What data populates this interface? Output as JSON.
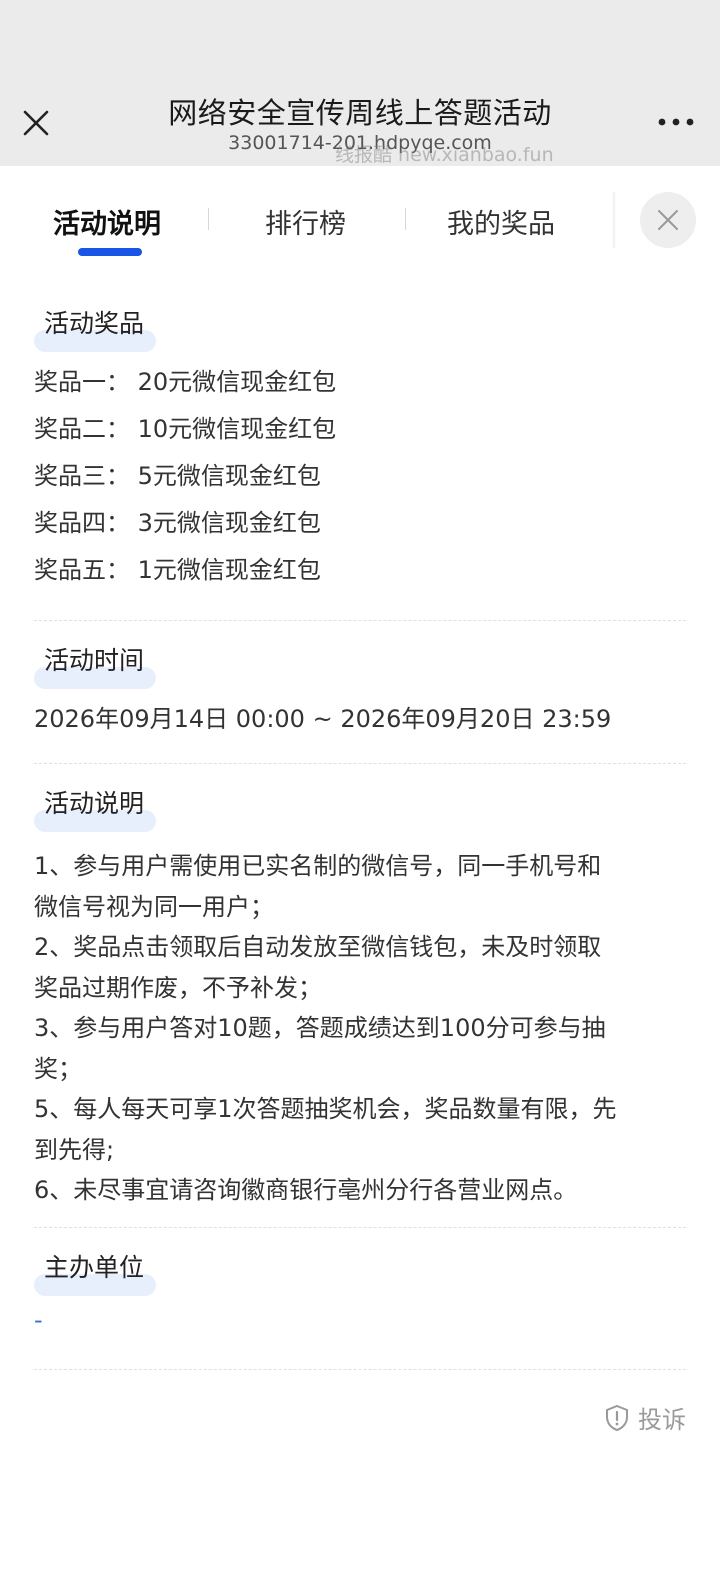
{
  "header": {
    "title": "网络安全宣传周线上答题活动",
    "url": "33001714-201.hdpyqe.com",
    "watermark": "线报酷 new.xianbao.fun",
    "close_icon": "close-icon",
    "more_icon": "more-icon"
  },
  "tabs": [
    {
      "label": "活动说明",
      "active": true
    },
    {
      "label": "排行榜",
      "active": false
    },
    {
      "label": "我的奖品",
      "active": false
    }
  ],
  "prizes": {
    "title": "活动奖品",
    "items": [
      "奖品一：  20元微信现金红包",
      "奖品二：  10元微信现金红包",
      "奖品三：  5元微信现金红包",
      "奖品四：  3元微信现金红包",
      "奖品五：  1元微信现金红包"
    ]
  },
  "time": {
    "title": "活动时间",
    "value": "2026年09月14日 00:00 ~ 2026年09月20日 23:59"
  },
  "rules": {
    "title": "活动说明",
    "lines": [
      "1、参与用户需使用已实名制的微信号，同一手机号和",
      "微信号视为同一用户；",
      "2、奖品点击领取后自动发放至微信钱包，未及时领取",
      "奖品过期作废，不予补发；",
      "3、参与用户答对10题，答题成绩达到100分可参与抽",
      "奖；",
      "5、每人每天可享1次答题抽奖机会，奖品数量有限，先",
      "到先得;",
      "6、未尽事宜请咨询徽商银行亳州分行各营业网点。"
    ]
  },
  "organizer": {
    "title": "主办单位",
    "value": "-"
  },
  "complain": {
    "label": "投诉",
    "icon": "shield-alert-icon"
  },
  "colors": {
    "accent": "#1a56e6",
    "title_highlight": "#e8effc",
    "topbar_bg": "#ebebeb"
  }
}
